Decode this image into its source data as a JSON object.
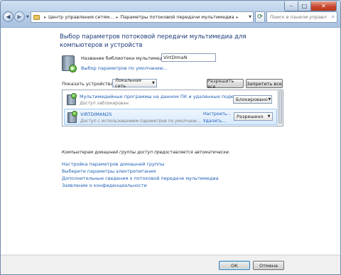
{
  "window": {
    "controls": {
      "minimize": "–",
      "maximize": "□",
      "close": "✕"
    }
  },
  "nav": {
    "back": "◀",
    "forward": "▶",
    "refresh": "⟳"
  },
  "address": {
    "crumbs": [
      "Центр управления сетям...",
      "Параметры потоковой передачи мультимедиа"
    ]
  },
  "search": {
    "placeholder": "Поиск в панели управления"
  },
  "heading": "Выбор параметров потоковой передачи мультимедиа для компьютеров и устройств",
  "library": {
    "label": "Название библиотеки мультимедиа:",
    "value": "VirtDImaN",
    "defaults_link": "Выбор параметров по умолчанию..."
  },
  "show": {
    "label": "Показать устройства на:",
    "selected": "Локальная сеть"
  },
  "buttons": {
    "allow_all": "Разрешить все",
    "deny_all": "Запретить все",
    "ok": "ОК",
    "cancel": "Отмена"
  },
  "devices": [
    {
      "title": "Мультимедийные программы на данном ПК и удаленные подключе...",
      "subtitle": "Доступ заблокирован.",
      "status": "Блокировано"
    },
    {
      "title": "VIRTDIMAN2S",
      "subtitle": "Доступ с использованием параметров по умолчани...",
      "action_customize": "Настроить...",
      "action_delete": "Удалить...",
      "status": "Разрешено"
    }
  ],
  "info": "Компьютерам домашней группы доступ предоставляется автоматически.",
  "links": [
    "Настройка параметров домашней группы",
    "Выберите параметры электропитания",
    "Дополнительные сведения о потоковой передаче мультимедиа",
    "Заявление о конфиденциальности"
  ],
  "colors": {
    "heading": "#1b3a78",
    "link": "#1f5fb4",
    "selected_row": "#d8eafc"
  }
}
